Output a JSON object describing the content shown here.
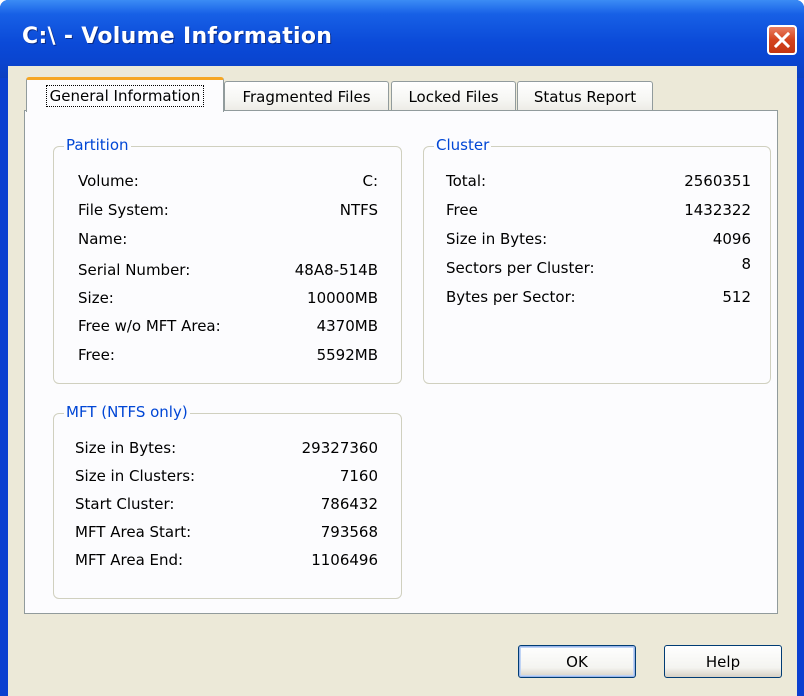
{
  "window": {
    "title": "C:\\ - Volume Information"
  },
  "tabs": [
    {
      "label": "General Information",
      "active": true
    },
    {
      "label": "Fragmented Files",
      "active": false
    },
    {
      "label": "Locked Files",
      "active": false
    },
    {
      "label": "Status Report",
      "active": false
    }
  ],
  "partition": {
    "title": "Partition",
    "rows": [
      {
        "label": "Volume:",
        "value": "C:"
      },
      {
        "label": "File System:",
        "value": "NTFS"
      },
      {
        "label": "Name:",
        "value": ""
      },
      {
        "label": "Serial Number:",
        "value": "48A8-514B"
      },
      {
        "label": "Size:",
        "value": "10000MB"
      },
      {
        "label": "Free w/o MFT Area:",
        "value": "4370MB"
      },
      {
        "label": "Free:",
        "value": "5592MB"
      }
    ]
  },
  "cluster": {
    "title": "Cluster",
    "rows": [
      {
        "label": "Total:",
        "value": "2560351"
      },
      {
        "label": "Free",
        "value": "1432322"
      },
      {
        "label": "Size in Bytes:",
        "value": "4096"
      },
      {
        "label": "Sectors per Cluster:",
        "value": "8"
      },
      {
        "label": "Bytes per Sector:",
        "value": "512"
      }
    ]
  },
  "mft": {
    "title": "MFT (NTFS only)",
    "rows": [
      {
        "label": "Size in Bytes:",
        "value": "29327360"
      },
      {
        "label": "Size in Clusters:",
        "value": "7160"
      },
      {
        "label": "Start Cluster:",
        "value": "786432"
      },
      {
        "label": "MFT Area Start:",
        "value": "793568"
      },
      {
        "label": "MFT Area End:",
        "value": "1106496"
      }
    ]
  },
  "buttons": {
    "ok": "OK",
    "help": "Help"
  },
  "icons": {
    "close": "close-icon"
  },
  "colors": {
    "title_bar": "#0a44cf",
    "group_title": "#0046d5",
    "active_tab_accent": "#f6a623",
    "close_button": "#d4431d"
  }
}
